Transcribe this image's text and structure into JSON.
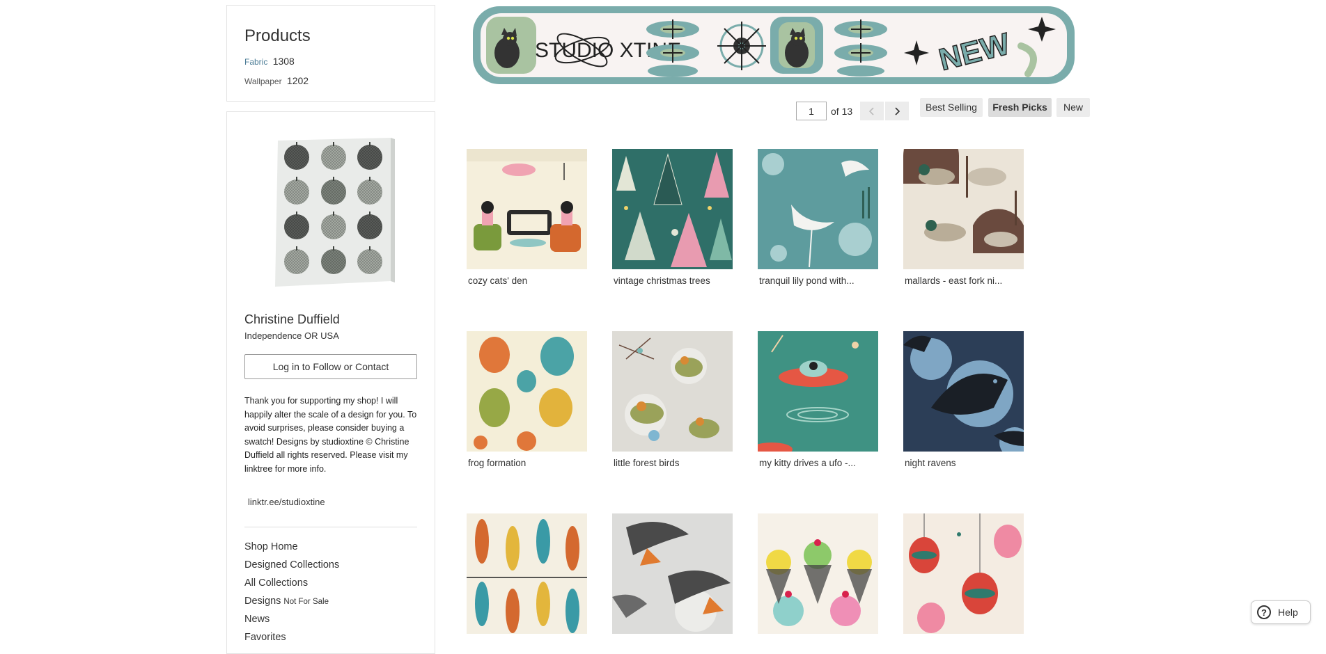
{
  "products": {
    "title": "Products",
    "items": [
      {
        "label": "Fabric",
        "count": "1308"
      },
      {
        "label": "Wallpaper",
        "count": "1202"
      }
    ]
  },
  "profile": {
    "name": "Christine Duffield",
    "location": "Independence OR USA",
    "follow_button": "Log in to Follow or Contact",
    "bio": "Thank you for supporting my shop! I will happily alter the scale of a design for you. To avoid surprises, please consider buying a swatch! Designs by studioxtine © Christine Duffield all rights reserved. Please visit my linktree for more info.",
    "link": "linktr.ee/studioxtine"
  },
  "nav": {
    "shop_home": "Shop Home",
    "designed_collections": "Designed Collections",
    "all_collections": "All Collections",
    "designs": "Designs",
    "designs_sub": "Not For Sale",
    "news": "News",
    "favorites": "Favorites"
  },
  "banner": {
    "brand": "STUDIO XTINE",
    "badge": "NEW"
  },
  "pagination": {
    "current": "1",
    "total_label": "of 13"
  },
  "sort": {
    "best_selling": "Best Selling",
    "fresh_picks": "Fresh Picks",
    "new": "New"
  },
  "designs": [
    {
      "title": "cozy cats' den"
    },
    {
      "title": "vintage christmas trees"
    },
    {
      "title": "tranquil lily pond with..."
    },
    {
      "title": "mallards - east fork ni..."
    },
    {
      "title": "frog formation"
    },
    {
      "title": "little forest birds"
    },
    {
      "title": "my kitty drives a ufo -..."
    },
    {
      "title": "night ravens"
    },
    {
      "title": ""
    },
    {
      "title": ""
    },
    {
      "title": ""
    },
    {
      "title": ""
    }
  ],
  "help": {
    "label": "Help"
  },
  "colors": {
    "accent_teal": "#7aacab",
    "link_blue": "#4a7b95"
  }
}
